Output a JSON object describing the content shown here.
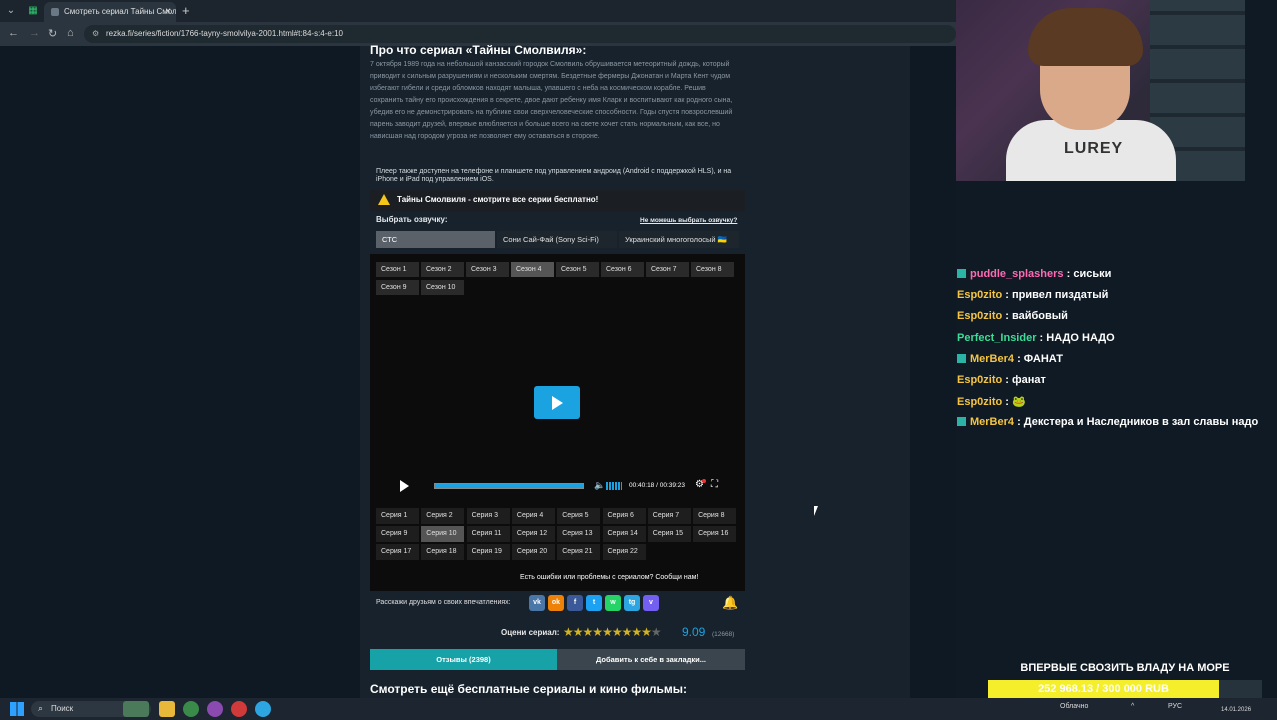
{
  "browser": {
    "tab_title": "Смотреть сериал Тайны Смолв",
    "url": "rezka.fi/series/fiction/1766-tayny-smolvilya-2001.html#t:84-s:4-e:10"
  },
  "page": {
    "about_title": "Про что сериал «Тайны Смолвиля»:",
    "description": "7 октября 1989 года на небольшой канзасский городок Смолвиль обрушивается метеоритный дождь, который приводит к сильным разрушениям и нескольким смертям. Бездетные фермеры Джонатан и Марта Кент чудом избегают гибели и среди обломков находят малыша, упавшего с неба на космическом корабле. Решив сохранить тайну его происхождения в секрете, двое дают ребенку имя Кларк и воспитывают как родного сына, убедив его не демонстрировать на публике свои сверхчеловеческие способности. Годы спустя повзрослевший парень заводит друзей, впервые влюбляется и больше всего на свете хочет стать нормальным, как все, но нависшая над городом угроза не позволяет ему оставаться в стороне.",
    "player_note": "Плеер также доступен на телефоне и планшете под управлением андроид (Android с поддержкой HLS), и на iPhone и iPad под управлением iOS.",
    "warning_text": "Тайны Смолвиля - смотрите все серии бесплатно!",
    "voice_label": "Выбрать озвучку:",
    "voice_help": "Не можешь выбрать озвучку?",
    "voices": [
      "СТС",
      "Сони Сай-Фай (Sony Sci-Fi)",
      "Украинский многоголосый 🇺🇦"
    ],
    "seasons": [
      "Сезон 1",
      "Сезон 2",
      "Сезон 3",
      "Сезон 4",
      "Сезон 5",
      "Сезон 6",
      "Сезон 7",
      "Сезон 8",
      "Сезон 9",
      "Сезон 10"
    ],
    "active_season": "Сезон 4",
    "episodes": [
      "Серия 1",
      "Серия 2",
      "Серия 3",
      "Серия 4",
      "Серия 5",
      "Серия 6",
      "Серия 7",
      "Серия 8",
      "Серия 9",
      "Серия 10",
      "Серия 11",
      "Серия 12",
      "Серия 13",
      "Серия 14",
      "Серия 15",
      "Серия 16",
      "Серия 17",
      "Серия 18",
      "Серия 19",
      "Серия 20",
      "Серия 21",
      "Серия 22"
    ],
    "active_episode": "Серия 10",
    "player_time": "00:40:18 / 00:39:23",
    "progress": 1.0,
    "report_text": "Есть ошибки или проблемы с сериалом? Сообщи нам!",
    "share_label": "Расскажи друзьям о своих впечатлениях:",
    "social": [
      {
        "label": "vk",
        "color": "#4a76a8"
      },
      {
        "label": "ok",
        "color": "#ee8208"
      },
      {
        "label": "f",
        "color": "#3b5998"
      },
      {
        "label": "t",
        "color": "#1da1f2"
      },
      {
        "label": "w",
        "color": "#25d366"
      },
      {
        "label": "tg",
        "color": "#2ca5e0"
      },
      {
        "label": "v",
        "color": "#7360f2"
      }
    ],
    "rating_label": "Оцени сериал:",
    "rating_score": "9.09",
    "rating_votes": "(12668)",
    "stars_filled": 9,
    "reviews_button": "Отзывы (2398)",
    "bookmark_button": "Добавить к себе в закладки...",
    "more_title": "Смотреть ещё бесплатные сериалы и кино фильмы:"
  },
  "stream": {
    "webcam_shirt": "LUREY",
    "chat": [
      {
        "user": "puddle_splashers",
        "color": "#ff69b4",
        "badge": true,
        "msg": ": сиськи"
      },
      {
        "user": "Esp0zito",
        "color": "#f5c542",
        "badge": false,
        "msg": ": привел пиздатый"
      },
      {
        "user": "Esp0zito",
        "color": "#f5c542",
        "badge": false,
        "msg": ": вайбовый"
      },
      {
        "user": "Perfect_Insider",
        "color": "#3ddc97",
        "badge": false,
        "msg": ": НАДО НАДО"
      },
      {
        "user": "MerBer4",
        "color": "#f5c542",
        "badge": true,
        "msg": ": ФАНАТ"
      },
      {
        "user": "Esp0zito",
        "color": "#f5c542",
        "badge": false,
        "msg": ": фанат"
      },
      {
        "user": "Esp0zito",
        "color": "#f5c542",
        "badge": false,
        "msg": ": 🐸"
      },
      {
        "user": "MerBer4",
        "color": "#f5c542",
        "badge": true,
        "msg": ": Декстера и Наследников в зал славы надо"
      }
    ],
    "goal_title": "ВПЕРВЫЕ СВОЗИТЬ ВЛАДУ НА МОРЕ",
    "goal_amount": "252 968.13 / 300 000 RUB",
    "goal_progress": 0.843
  },
  "taskbar": {
    "search": "Поиск",
    "weather": "Облачно",
    "lang": "РУС",
    "date": "14.01.2026"
  }
}
